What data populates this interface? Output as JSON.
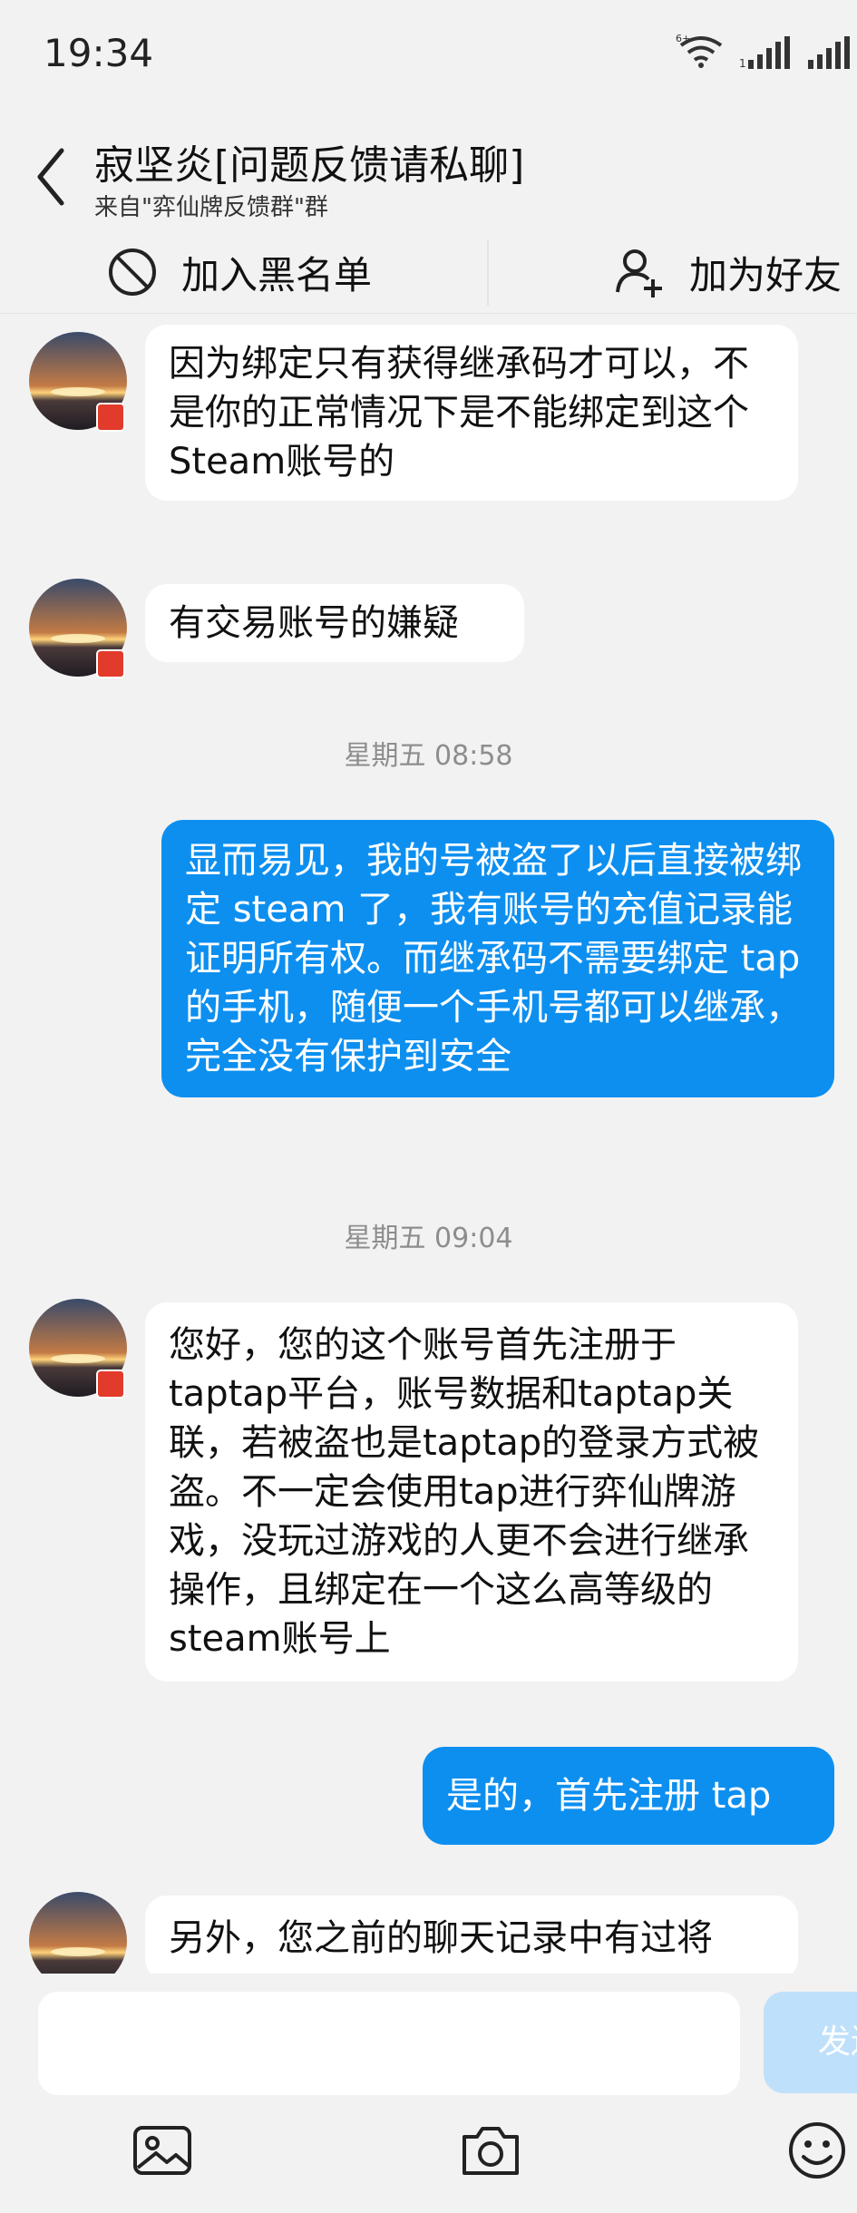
{
  "status_bar": {
    "time": "19:34",
    "network_label": "6+"
  },
  "header": {
    "title": "寂坚炎[问题反馈请私聊]",
    "subtitle": "来自\"弈仙牌反馈群\"群"
  },
  "actions": {
    "block_label": "加入黑名单",
    "add_friend_label": "加为好友"
  },
  "messages": [
    {
      "dir": "in",
      "text": "因为绑定只有获得继承码才可以，不是你的正常情况下是不能绑定到这个Steam账号的"
    },
    {
      "dir": "in",
      "text": "有交易账号的嫌疑"
    },
    {
      "type": "timestamp",
      "text": "星期五 08:58"
    },
    {
      "dir": "out",
      "text": "显而易见，我的号被盗了以后直接被绑定 steam 了，我有账号的充值记录能证明所有权。而继承码不需要绑定 tap 的手机，随便一个手机号都可以继承，完全没有保护到安全"
    },
    {
      "type": "timestamp",
      "text": "星期五 09:04"
    },
    {
      "dir": "in",
      "text": "您好，您的这个账号首先注册于taptap平台，账号数据和taptap关联，若被盗也是taptap的登录方式被盗。不一定会使用tap进行弈仙牌游戏，没玩过游戏的人更不会进行继承操作，且绑定在一个这么高等级的steam账号上"
    },
    {
      "dir": "out",
      "text": "是的，首先注册 tap"
    },
    {
      "dir": "in",
      "text": "另外，您之前的聊天记录中有过将"
    }
  ],
  "composer": {
    "placeholder": "",
    "send_label": "发送"
  },
  "colors": {
    "outgoing_bubble": "#0d8ff0",
    "incoming_bubble": "#ffffff",
    "background": "#f2f2f2",
    "send_button": "#bfe0fb"
  },
  "icons": [
    "back-icon",
    "block-icon",
    "add-friend-icon",
    "image-icon",
    "camera-icon",
    "emoji-icon"
  ]
}
